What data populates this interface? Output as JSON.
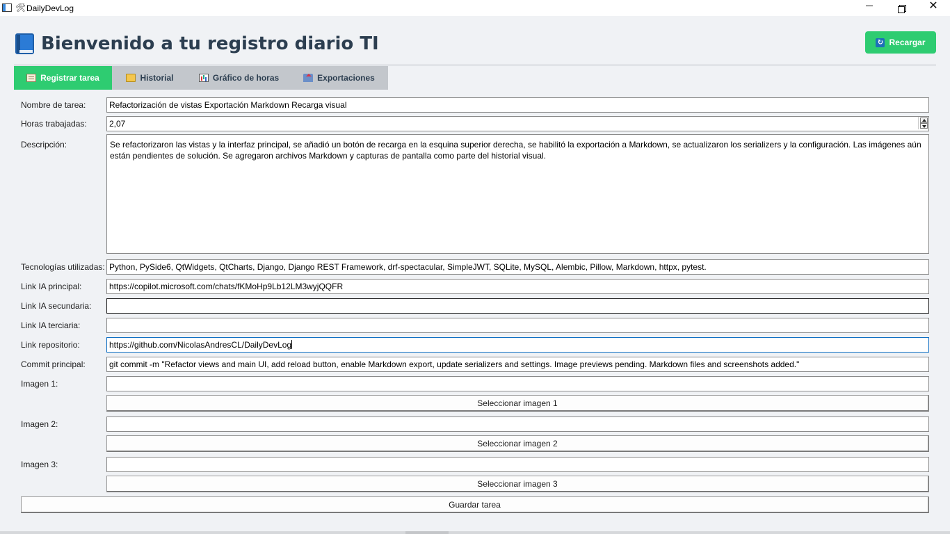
{
  "window": {
    "title": "DailyDevLog",
    "title_icon": "tools-icon",
    "title_glyph": "🛠"
  },
  "header": {
    "title": "Bienvenido a tu registro diario TI",
    "title_icon": "blue-book-icon",
    "reload_label": "Recargar",
    "reload_icon": "reload-icon",
    "reload_glyph": "🔄",
    "accent_color": "#2ecc71",
    "title_color": "#2c3e50"
  },
  "tabs": [
    {
      "label": "Registrar tarea",
      "icon": "memo-icon",
      "active": true
    },
    {
      "label": "Historial",
      "icon": "folder-icon",
      "active": false
    },
    {
      "label": "Gráfico de horas",
      "icon": "bar-chart-icon",
      "active": false
    },
    {
      "label": "Exportaciones",
      "icon": "outbox-icon",
      "active": false
    }
  ],
  "form": {
    "task_name": {
      "label": "Nombre de tarea:",
      "value": "Refactorización de vistas Exportación Markdown Recarga visual"
    },
    "hours": {
      "label": "Horas trabajadas:",
      "value": "2,07"
    },
    "description": {
      "label": "Descripción:",
      "value": "Se refactorizaron las vistas y la interfaz principal, se añadió un botón de recarga en la esquina superior derecha, se habilitó la exportación a Markdown, se actualizaron los serializers y la configuración. Las imágenes aún están pendientes de solución. Se agregaron archivos Markdown y capturas de pantalla como parte del historial visual."
    },
    "technologies": {
      "label": "Tecnologías utilizadas:",
      "value": "Python, PySide6, QtWidgets, QtCharts, Django, Django REST Framework, drf-spectacular, SimpleJWT, SQLite, MySQL, Alembic, Pillow, Markdown, httpx, pytest."
    },
    "ai_link_main": {
      "label": "Link IA principal:",
      "value": "https://copilot.microsoft.com/chats/fKMoHp9Lb12LM3wyjQQFR"
    },
    "ai_link_secondary": {
      "label": "Link IA secundaria:",
      "value": ""
    },
    "ai_link_tertiary": {
      "label": "Link IA terciaria:",
      "value": ""
    },
    "repo_link": {
      "label": "Link repositorio:",
      "value": "https://github.com/NicolasAndresCL/DailyDevLog"
    },
    "commit": {
      "label": "Commit principal:",
      "value": "git commit -m \"Refactor views and main UI, add reload button, enable Markdown export, update serializers and settings. Image previews pending. Markdown files and screenshots added.\""
    },
    "image1": {
      "label": "Imagen 1:",
      "value": "",
      "button": "Seleccionar imagen 1"
    },
    "image2": {
      "label": "Imagen 2:",
      "value": "",
      "button": "Seleccionar imagen 2"
    },
    "image3": {
      "label": "Imagen 3:",
      "value": "",
      "button": "Seleccionar imagen 3"
    },
    "save_button": "Guardar tarea"
  }
}
